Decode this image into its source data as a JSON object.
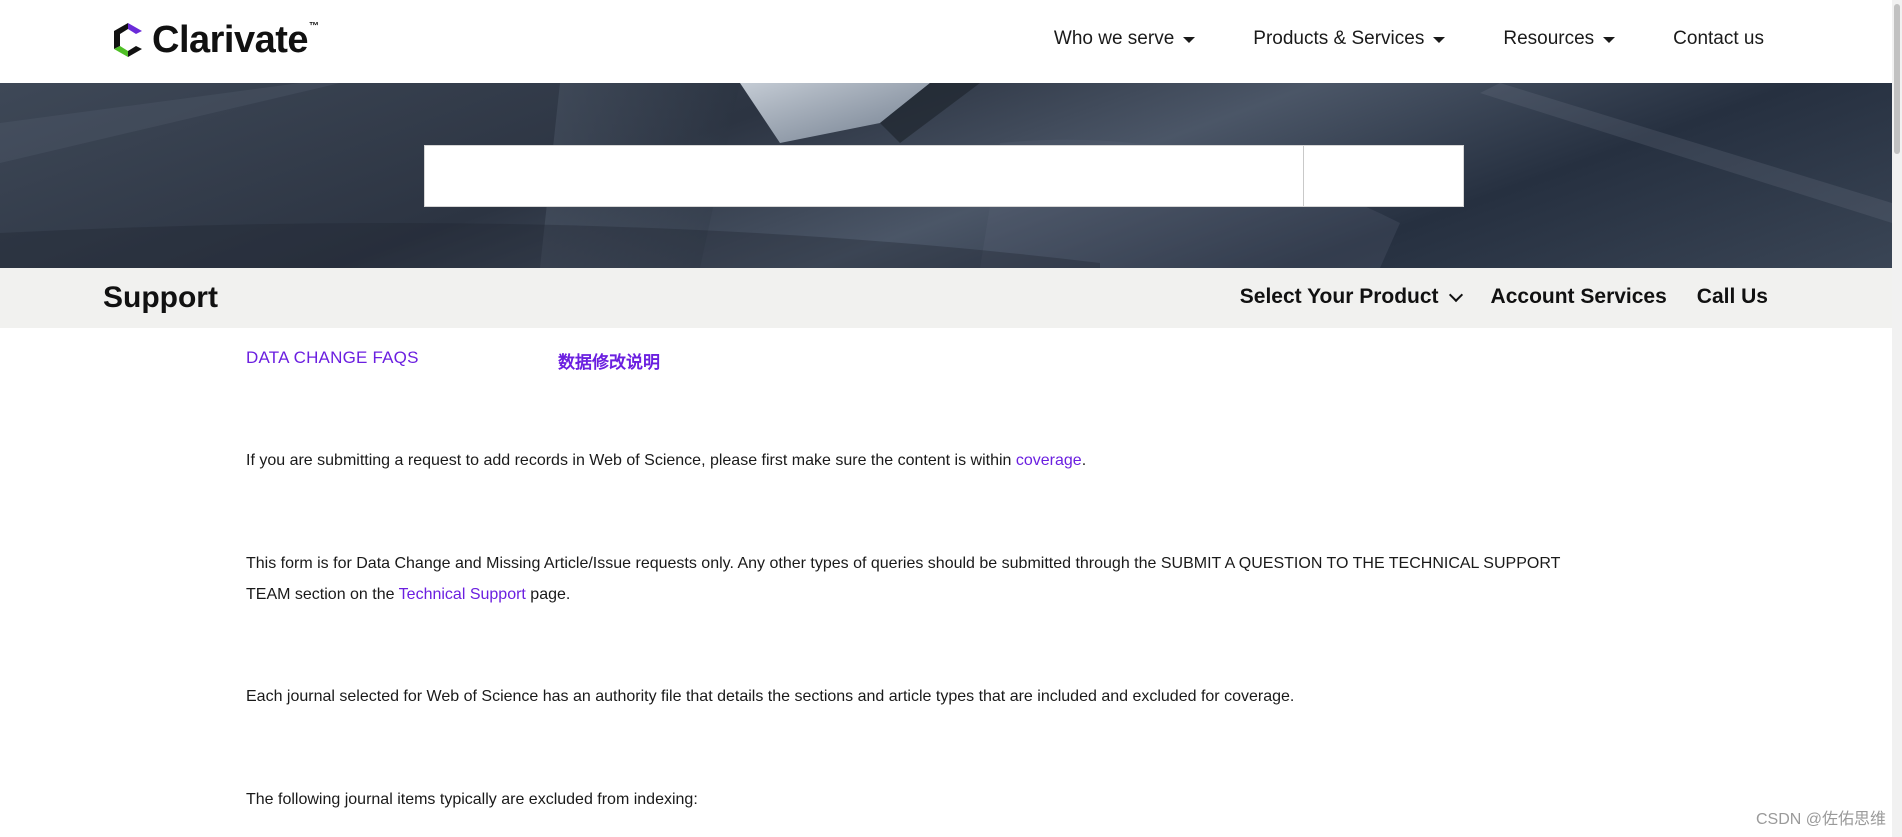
{
  "header": {
    "logo_text": "Clarivate",
    "logo_tm": "™",
    "nav": [
      {
        "label": "Who we serve",
        "has_dropdown": true
      },
      {
        "label": "Products & Services",
        "has_dropdown": true
      },
      {
        "label": "Resources",
        "has_dropdown": true
      },
      {
        "label": "Contact us",
        "has_dropdown": false
      }
    ]
  },
  "search": {
    "value": "",
    "placeholder": ""
  },
  "support_bar": {
    "title": "Support",
    "links": [
      {
        "label": "Select Your Product",
        "has_dropdown": true
      },
      {
        "label": "Account Services"
      },
      {
        "label": "Call Us"
      }
    ]
  },
  "content": {
    "tab_en": "DATA CHANGE FAQS",
    "tab_cn": "数据修改说明",
    "p1": {
      "text": "If you are submitting a request to add records in Web of Science, please first make sure the content is within ",
      "link": "coverage",
      "tail": "."
    },
    "p2": {
      "text": "This form is for Data Change and Missing Article/Issue requests only. Any other types of queries should be submitted through the SUBMIT A QUESTION TO THE TECHNICAL SUPPORT TEAM section on the ",
      "link": "Technical Support",
      "tail": " page."
    },
    "p3": "Each journal selected for Web of Science has an authority file that details the sections and article types that are included and excluded for coverage.",
    "p4": "The following journal items typically are excluded from indexing:"
  },
  "watermark": "CSDN @佐佑思维",
  "colors": {
    "link": "#6b1fe0",
    "support_bar_bg": "#f1f1ef",
    "logo_purple": "#6b2bd9",
    "logo_green": "#4fbf26"
  },
  "icons": {
    "logo": "clarivate-logo-icon",
    "nav_dropdown": "caret-down-icon",
    "product_dropdown": "chevron-down-icon"
  }
}
